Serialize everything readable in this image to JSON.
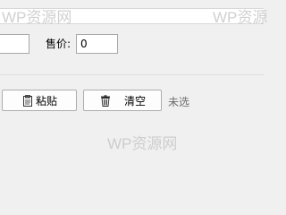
{
  "form": {
    "price_label": "售价:",
    "price_value": "0"
  },
  "toolbar": {
    "paste_label": "粘贴",
    "clear_label": "清空",
    "status": "未选"
  },
  "watermarks": {
    "top_left": "WP资源网",
    "top_right": "WP资源",
    "center": "WP资源网"
  },
  "icons": {
    "paste": "clipboard-icon",
    "clear": "trash-can-icon"
  }
}
